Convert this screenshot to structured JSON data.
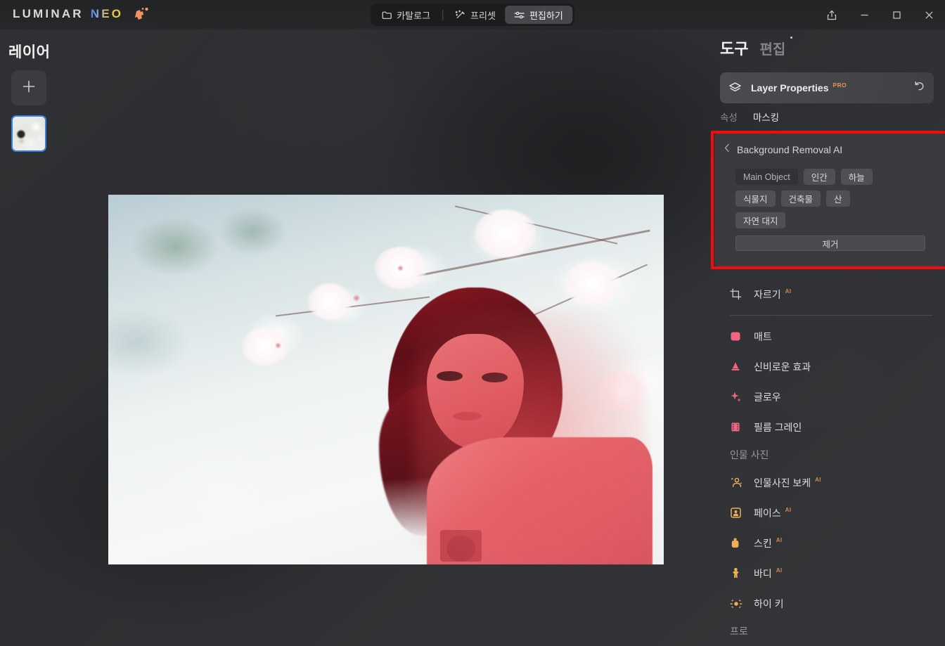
{
  "app": {
    "brand_first": "LUMINAR",
    "brand_second": "NEO"
  },
  "titlebar": {
    "tabs": [
      {
        "label": "카탈로그",
        "icon": "folder-icon",
        "active": false
      },
      {
        "label": "프리셋",
        "icon": "wand-sparkle-icon",
        "active": false
      },
      {
        "label": "편집하기",
        "icon": "sliders-icon",
        "active": true
      }
    ],
    "window_controls": [
      {
        "name": "share-button",
        "icon": "share-icon"
      },
      {
        "name": "minimize-button",
        "icon": "minimize-icon"
      },
      {
        "name": "maximize-button",
        "icon": "maximize-icon"
      },
      {
        "name": "close-button",
        "icon": "close-icon"
      }
    ]
  },
  "left_panel": {
    "title": "레이어",
    "add_layer_icon": "plus-icon",
    "layers": [
      {
        "name": "layer-thumbnail-1",
        "selected": true
      }
    ]
  },
  "right_panel": {
    "tab_primary": "도구",
    "tab_secondary": "편집",
    "tool_card": {
      "title": "Layer Properties",
      "badge": "PRO",
      "icon": "layers-icon",
      "reset_icon": "reset-arrow-icon"
    },
    "sub_tabs": [
      {
        "label": "속성",
        "active": false
      },
      {
        "label": "마스킹",
        "active": true
      }
    ],
    "background_removal": {
      "back_icon": "chevron-left-icon",
      "title": "Background Removal AI",
      "chips": [
        {
          "label": "Main Object",
          "selected": true
        },
        {
          "label": "인간",
          "selected": false
        },
        {
          "label": "하늘",
          "selected": false
        },
        {
          "label": "식물지",
          "selected": false
        },
        {
          "label": "건축물",
          "selected": false
        },
        {
          "label": "산",
          "selected": false
        },
        {
          "label": "자연 대지",
          "selected": false
        }
      ],
      "remove_button": "제거"
    },
    "tools": [
      {
        "type": "item",
        "label": "자르기",
        "ai": "AI",
        "icon": "crop-icon",
        "color": "#cfd0d2"
      },
      {
        "type": "divider"
      },
      {
        "type": "item",
        "label": "매트",
        "ai": "",
        "icon": "matte-icon",
        "color": "#f2647f"
      },
      {
        "type": "item",
        "label": "신비로운 효과",
        "ai": "",
        "icon": "mystical-icon",
        "color": "#f2647f"
      },
      {
        "type": "item",
        "label": "글로우",
        "ai": "",
        "icon": "glow-icon",
        "color": "#f2647f"
      },
      {
        "type": "item",
        "label": "필름 그레인",
        "ai": "",
        "icon": "film-grain-icon",
        "color": "#f2647f"
      },
      {
        "type": "section",
        "label": "인물 사진"
      },
      {
        "type": "item",
        "label": "인물사진 보케",
        "ai": "AI",
        "icon": "portrait-bokeh-icon",
        "color": "#f0b055"
      },
      {
        "type": "item",
        "label": "페이스",
        "ai": "AI",
        "icon": "face-icon",
        "color": "#f0b055"
      },
      {
        "type": "item",
        "label": "스킨",
        "ai": "AI",
        "icon": "skin-icon",
        "color": "#f0b055"
      },
      {
        "type": "item",
        "label": "바디",
        "ai": "AI",
        "icon": "body-icon",
        "color": "#f0b055"
      },
      {
        "type": "item",
        "label": "하이 키",
        "ai": "",
        "icon": "high-key-icon",
        "color": "#f0b055"
      },
      {
        "type": "section",
        "label": "프로"
      }
    ]
  },
  "colors": {
    "highlight_box": "#f40c0c",
    "accent_pro": "#e7965a",
    "layer_selected_border": "#3b7fe0",
    "tool_pink": "#f2647f",
    "tool_orange": "#f0b055"
  }
}
